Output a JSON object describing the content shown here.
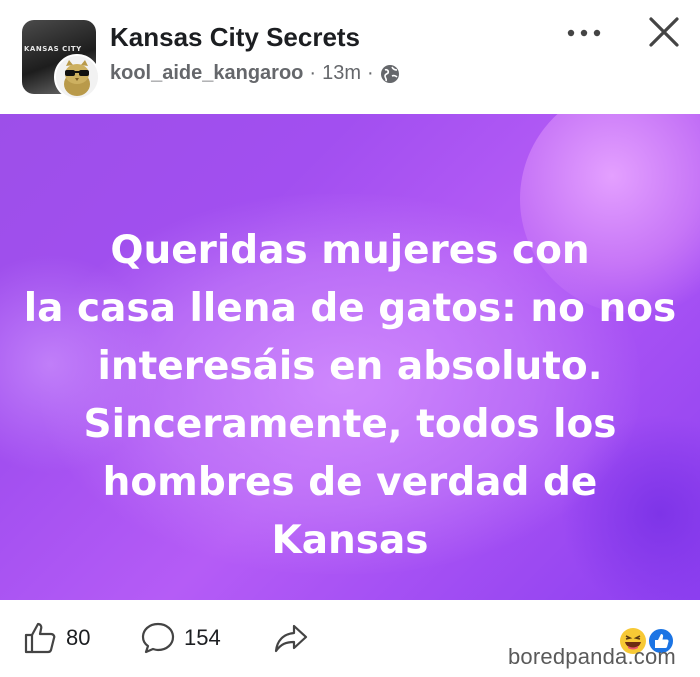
{
  "header": {
    "group_name": "Kansas City Secrets",
    "group_avatar_text": "KANSAS CITY",
    "author": "kool_aide_kangaroo",
    "time": "13m",
    "separator": "·",
    "privacy_icon": "globe-icon",
    "more_icon": "more-horizontal-icon",
    "close_icon": "close-icon"
  },
  "post": {
    "lines": [
      "Queridas mujeres con",
      "la casa llena de gatos: no nos",
      "interesáis en absoluto.",
      "Sinceramente, todos los",
      "hombres de verdad de",
      "Kansas"
    ],
    "bg_colors": [
      "#9d4fe9",
      "#b55cf6",
      "#e4a0ff"
    ]
  },
  "footer": {
    "like_icon": "thumbs-up-icon",
    "like_count": "80",
    "comment_icon": "comment-icon",
    "comment_count": "154",
    "share_icon": "share-icon",
    "reaction_icons": [
      "haha-emoji-icon",
      "like-reaction-icon"
    ],
    "watermark": "boredpanda.com"
  }
}
